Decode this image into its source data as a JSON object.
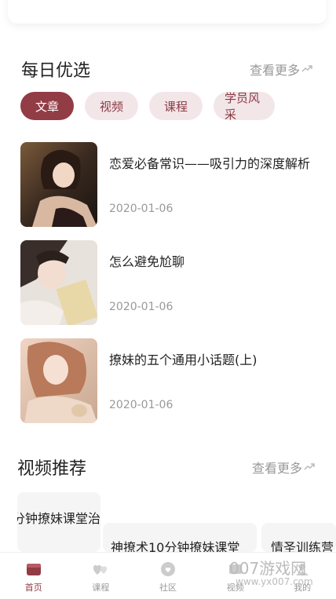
{
  "daily": {
    "title": "每日优选",
    "more": "查看更多",
    "tabs": [
      "文章",
      "视频",
      "课程",
      "学员风采"
    ],
    "articles": [
      {
        "title": "恋爱必备常识——吸引力的深度解析",
        "date": "2020-01-06"
      },
      {
        "title": "怎么避免尬聊",
        "date": "2020-01-06"
      },
      {
        "title": "撩妹的五个通用小话题(上)",
        "date": "2020-01-06"
      }
    ]
  },
  "videos": {
    "title": "视频推荐",
    "more": "查看更多",
    "cards": [
      {
        "title": "分钟撩妹课堂治"
      },
      {
        "title": "神撩术10分钟撩妹课堂"
      },
      {
        "title": "情圣训练营"
      }
    ]
  },
  "nav": {
    "items": [
      "首页",
      "课程",
      "社区",
      "视频",
      "我的"
    ]
  },
  "watermark": {
    "text": "007游戏网",
    "url": "www.yx007.com"
  },
  "colors": {
    "accent": "#923c45",
    "tab_bg": "#f3e6e8"
  }
}
